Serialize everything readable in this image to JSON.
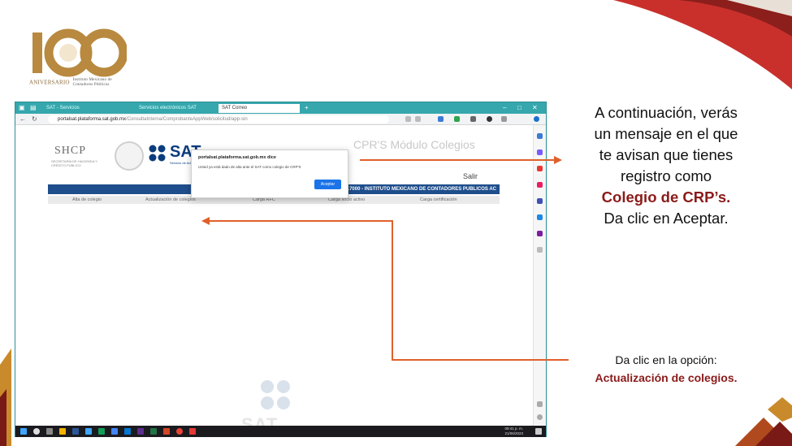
{
  "logo": {
    "number": "100",
    "caption": "ANIVERSARIO",
    "institution": "Instituto Mexicano de Contadores Públicos"
  },
  "browser": {
    "tabs": [
      "SAT - Servicios",
      "Servicios electrónicos SAT",
      "SAT Correo"
    ],
    "url_host": "portalsat.plataforma.sat.gob.mx",
    "url_rest": "/ConsultaInterna/ComprobanteAppWeb/solicitud/app-sin"
  },
  "page": {
    "shcp": "SHCP",
    "shcp_sub": "SECRETARÍA DE HACIENDA Y CRÉDITO PÚBLICO",
    "sat": "SAT",
    "sat_sub": "Servicio de Administración Tributaria",
    "heading": "CPR'S Módulo Colegios",
    "salir": "Salir",
    "institution_bar": "IMC551117000 - INSTITUTO MEXICANO DE CONTADORES PUBLICOS AC",
    "menu": [
      "Alta de colegio",
      "Actualización de colegios",
      "Carga RFC",
      "Carga socio activo",
      "Carga certificación"
    ],
    "watermark": "SAT"
  },
  "dialog": {
    "title": "portalsat.plataforma.sat.gob.mx dice",
    "message": "Usted ya está dado de alta ante el SAT como colegio de CRP'S",
    "button": "Aceptar"
  },
  "taskbar": {
    "time": "09:41 p. m.",
    "date": "21/06/2023"
  },
  "annotations": {
    "note1_lines": [
      "A continuación, verás",
      "un mensaje en el que",
      "te avisan que tienes",
      "registro como"
    ],
    "note1_highlight": "Colegio de CRP’s.",
    "note1_last": "Da clic en Aceptar.",
    "note2_line": "Da clic en la opción:",
    "note2_highlight": "Actualización de colegios."
  },
  "colors": {
    "accent_red": "#8b1a1a",
    "arrow": "#e0602b",
    "bar_blue": "#1f4e8c",
    "titlebar_teal": "#35a7ad"
  }
}
